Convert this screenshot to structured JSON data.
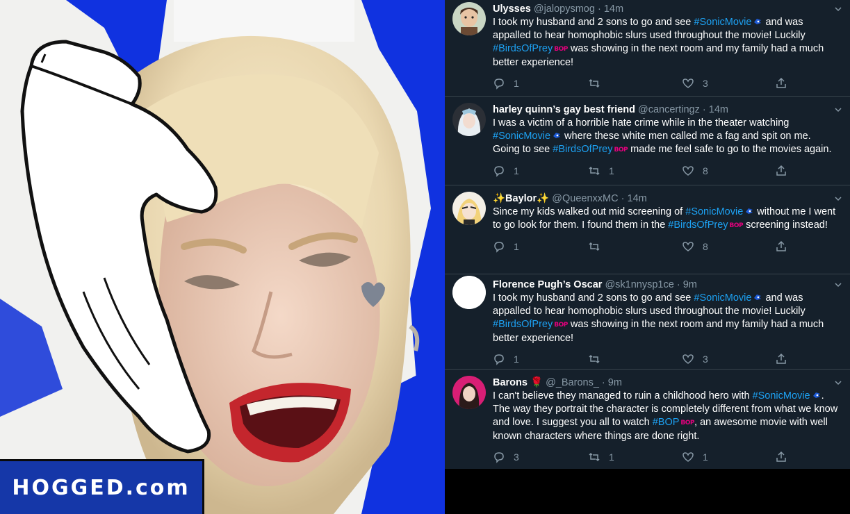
{
  "meme": {
    "watermark": "HOGGED.com",
    "colors": {
      "blue": "#1032e0",
      "watermark_bg": "#1537a8"
    }
  },
  "feed": {
    "colors": {
      "background": "#15202b",
      "divider": "#38444d",
      "muted": "#8899a6",
      "link": "#1da1f2",
      "bop": "#e6007e"
    },
    "tweets": [
      {
        "name": "Ulysses",
        "handle": "@jalopysmog",
        "dot": "·",
        "time": "14m",
        "avatar": "avatar-boy",
        "text": {
          "t1": "I took my husband and 2 sons to go and see ",
          "tag1": "#SonicMovie",
          "t2": "  and was appalled to hear homophobic slurs used throughout the movie! Luckily ",
          "tag2": "#BirdsOfPrey",
          "t3": "  was showing in the next room and my family had a much better experience!"
        },
        "bop": "BOP",
        "replies": "1",
        "retweets": "",
        "likes": "3"
      },
      {
        "name": "harley quinn’s gay best friend",
        "handle": "@cancertingz",
        "dot": "·",
        "time": "14m",
        "avatar": "avatar-harley",
        "text": {
          "t1": "I was a victim of a horrible hate crime while in the theater watching ",
          "tag1": "#SonicMovie",
          "t2": " where these white men called me a fag and spit on me. Going to see ",
          "tag2": "#BirdsOfPrey",
          "t3": " made me feel safe to go to the movies again."
        },
        "bop": "BOP",
        "replies": "1",
        "retweets": "1",
        "likes": "8"
      },
      {
        "name": "✨Baylor✨",
        "handle": "@QueenxxMC",
        "dot": "·",
        "time": "14m",
        "avatar": "avatar-cartoon",
        "text": {
          "t1": "Since my kids walked out mid screening of ",
          "tag1": "#SonicMovie",
          "t2": " without me I went to go look for them. I found them in the ",
          "tag2": "#BirdsOfPrey",
          "t3": " screening instead!"
        },
        "bop": "BOP",
        "replies": "1",
        "retweets": "",
        "likes": "8"
      },
      {
        "name": "Florence Pugh’s Oscar",
        "handle": "@sk1nnysp1ce",
        "dot": "·",
        "time": "9m",
        "avatar": "avatar-blank",
        "text": {
          "t1": "I took my husband and 2 sons to go and see ",
          "tag1": "#SonicMovie",
          "t2": "    and was appalled to hear homophobic slurs used throughout the movie! Luckily ",
          "tag2": "#BirdsOfPrey",
          "t3": "    was showing in the next room and my family had a much better experience!"
        },
        "bop": "BOP",
        "replies": "1",
        "retweets": "",
        "likes": "3"
      },
      {
        "name": "Barons",
        "name_emoji": "🌹",
        "handle": "@_Barons_",
        "dot": "·",
        "time": "9m",
        "avatar": "avatar-rose",
        "text": {
          "t1": "I can't believe they managed to ruin a childhood hero with ",
          "tag1": "#SonicMovie",
          "t2": ". The way they portrait the character is completely different from what we know and love. I suggest you all to watch ",
          "tag2": "#BOP",
          "t3": ", an awesome movie with well known characters where things are done right."
        },
        "bop": "BOP",
        "replies": "3",
        "retweets": "1",
        "likes": "1"
      }
    ]
  }
}
